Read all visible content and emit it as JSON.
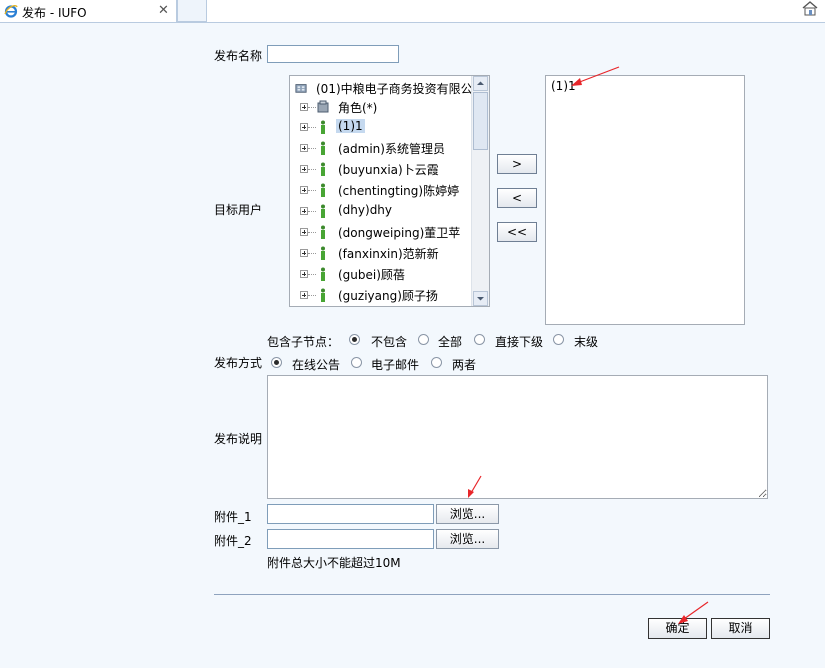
{
  "tab": {
    "title": "发布 - IUFO",
    "close": "✕"
  },
  "form": {
    "publish_name_label": "发布名称",
    "publish_name_value": "",
    "target_users_label": "目标用户",
    "include_children_label": "包含子节点：",
    "include_options": [
      "不包含",
      "全部",
      "直接下级",
      "末级"
    ],
    "include_selected": "不包含",
    "publish_method_label": "发布方式",
    "method_options": [
      "在线公告",
      "电子邮件",
      "两者"
    ],
    "method_selected": "在线公告",
    "description_label": "发布说明",
    "attachment1_label": "附件_1",
    "attachment2_label": "附件_2",
    "browse_label": "浏览...",
    "size_note": "附件总大小不能超过10M"
  },
  "tree": {
    "root": "(01)中粮电子商务投资有限公司",
    "items": [
      "角色(*)",
      "(1)1",
      "(admin)系统管理员",
      "(buyunxia)卜云霞",
      "(chentingting)陈婷婷",
      "(dhy)dhy",
      "(dongweiping)董卫苹",
      "(fanxinxin)范新新",
      "(gubei)顾蓓",
      "(guziyang)顾子扬"
    ],
    "selected": "(1)1"
  },
  "move_buttons": {
    "add": ">",
    "remove": "<",
    "remove_all": "<<"
  },
  "selected_users": [
    "(1)1"
  ],
  "actions": {
    "ok": "确定",
    "cancel": "取消"
  },
  "colors": {
    "background": "#f3f8fd",
    "annotation_arrow": "#e8262a",
    "selection": "#c5d9ef"
  }
}
